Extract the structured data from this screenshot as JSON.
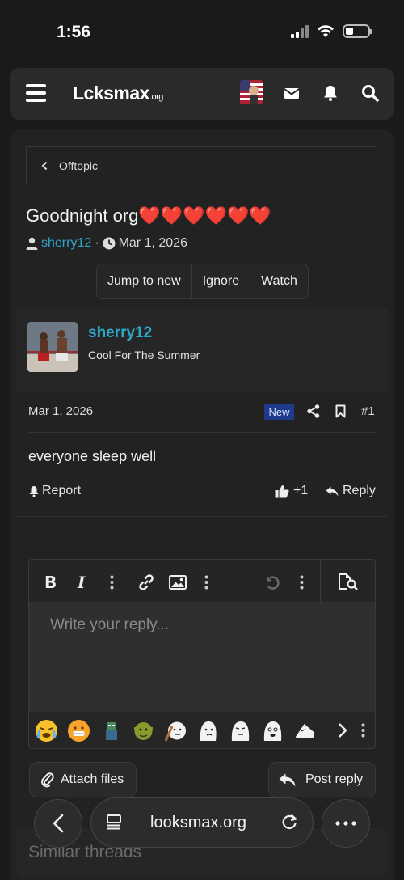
{
  "status": {
    "time": "1:56"
  },
  "header": {
    "logo_main": "Lcksmax",
    "logo_suffix": ".org"
  },
  "breadcrumb": {
    "label": "Offtopic"
  },
  "thread": {
    "title": "Goodnight org❤️❤️❤️❤️❤️❤️",
    "author": "sherry12",
    "separator": "·",
    "date": "Mar 1, 2026",
    "actions": [
      "Jump to new",
      "Ignore",
      "Watch"
    ]
  },
  "post": {
    "username": "sherry12",
    "user_title": "Cool For The Summer",
    "date": "Mar 1, 2026",
    "badge": "New",
    "number": "#1",
    "body": "everyone sleep well",
    "report_label": "Report",
    "like_count": "+1",
    "reply_label": "Reply"
  },
  "editor": {
    "placeholder": "Write your reply...",
    "toolbar": [
      "bold-icon",
      "italic-icon",
      "more-icon",
      "link-icon",
      "image-icon",
      "more-icon",
      "undo-icon",
      "more-icon",
      "preview-icon"
    ],
    "emojis": [
      "crying-emoji",
      "grimace-emoji",
      "goblin-emoji",
      "shrek-emoji",
      "wojak-emoji",
      "wojak-emoji",
      "wojak-emoji",
      "wojak-emoji",
      "wojak-emoji"
    ]
  },
  "buttons": {
    "attach": "Attach files",
    "post_reply": "Post reply"
  },
  "similar": {
    "title": "Similar threads"
  },
  "browser": {
    "url": "looksmax.org"
  },
  "colors": {
    "accent": "#2ba8c8",
    "badge_bg": "#1f3a8a",
    "background": "#1a1a1a"
  }
}
